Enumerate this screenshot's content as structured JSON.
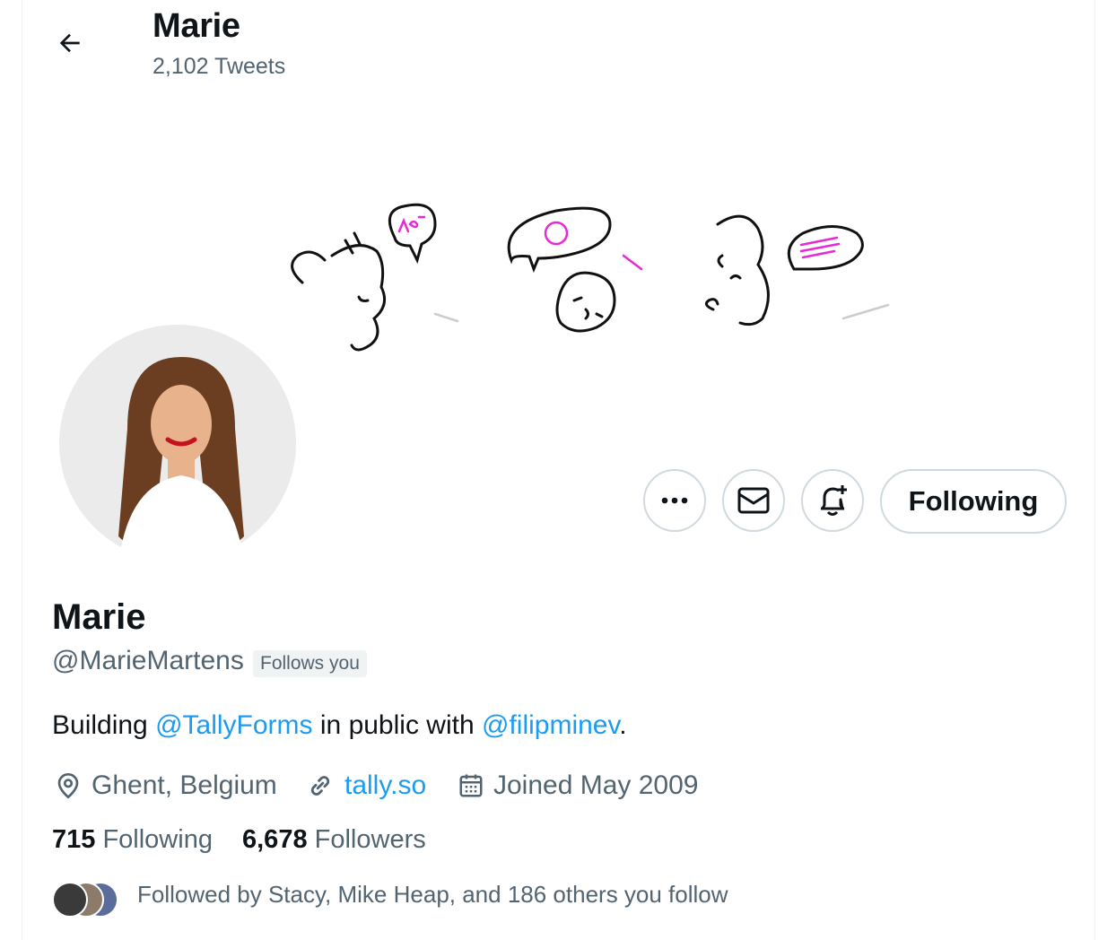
{
  "header": {
    "name": "Marie",
    "tweet_count": "2,102 Tweets"
  },
  "actions": {
    "follow_state_label": "Following"
  },
  "profile": {
    "display_name": "Marie",
    "handle": "@MarieMartens",
    "follows_you_badge": "Follows you",
    "bio": {
      "prefix": "Building ",
      "mention1": "@TallyForms",
      "middle": " in public with ",
      "mention2": "@filipminev",
      "suffix": "."
    },
    "location": "Ghent, Belgium",
    "website": "tally.so",
    "joined": "Joined May 2009"
  },
  "stats": {
    "following_count": "715",
    "following_label": "Following",
    "followers_count": "6,678",
    "followers_label": "Followers"
  },
  "followed_by_text": "Followed by Stacy, Mike Heap, and 186 others you follow",
  "colors": {
    "accent": "#1d9bf0",
    "secondary_text": "#536471",
    "primary_text": "#0f1419",
    "banner_highlight": "#e62ad6"
  }
}
